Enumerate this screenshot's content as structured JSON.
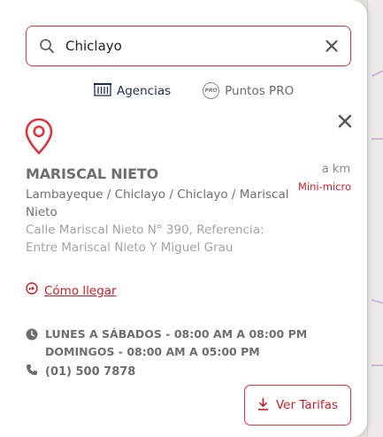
{
  "search": {
    "value": "Chiclayo",
    "placeholder": ""
  },
  "tabs": [
    {
      "label": "Agencias",
      "icon": "building-icon",
      "active": true
    },
    {
      "label": "Puntos PRO",
      "icon": "pro-badge-icon",
      "badge_text": "PRO",
      "active": false
    }
  ],
  "agency": {
    "name": "MARISCAL NIETO",
    "distance": "a km",
    "type": "Mini-micro",
    "region": "Lambayeque / Chiclayo / Chiclayo / Mariscal Nieto",
    "address": "Calle Mariscal Nieto N° 390, Referencia: Entre Mariscal Nieto Y Miguel Grau",
    "directions_label": "Cómo llegar",
    "hours": [
      "LUNES A SÁBADOS - 08:00 AM A 08:00 PM",
      "DOMINGOS - 08:00 AM A 05:00 PM"
    ],
    "phone": "(01) 500 7878",
    "tarifas_label": "Ver Tarifas"
  },
  "colors": {
    "accent": "#c8202a",
    "border_accent": "#d9363e",
    "text_dark": "#1f2d4d",
    "text_gray": "#6e6e6e"
  }
}
